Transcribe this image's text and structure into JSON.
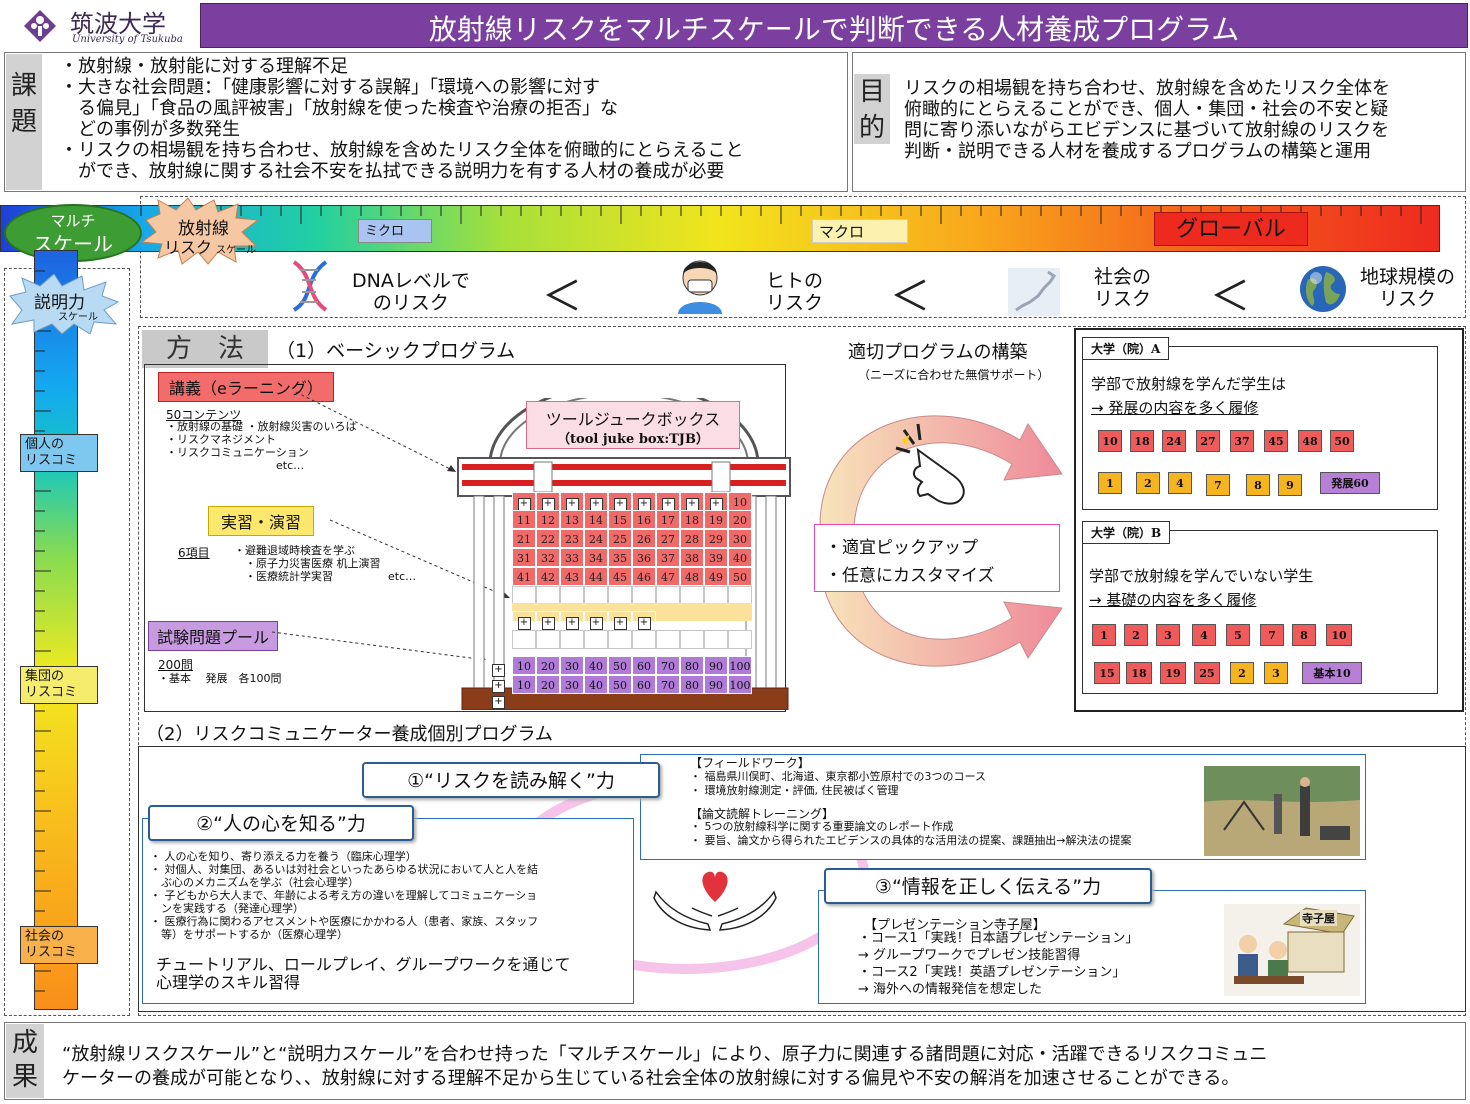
{
  "header": {
    "logo_jp": "筑波大学",
    "logo_en": "University of Tsukuba",
    "title": "放射線リスクをマルチスケールで判断できる人材養成プログラム"
  },
  "issue": {
    "label": "課題",
    "items": [
      "・放射線・放射能に対する理解不足",
      "・大きな社会問題：「健康影響に対する誤解」「環境への影響に対す",
      "　る偏見」「食品の風評被害」「放射線を使った検査や治療の拒否」な",
      "　どの事例が多数発生",
      "・リスクの相場観を持ち合わせ、放射線を含めたリスク全体を俯瞰的にとらえること",
      "　ができ、放射線に関する社会不安を払拭できる説明力を有する人材の養成が必要"
    ]
  },
  "purpose": {
    "label": "目的",
    "lines": [
      "リスクの相場観を持ち合わせ、放射線を含めたリスク全体を",
      "俯瞰的にとらえることができ、個人・集団・社会の不安と疑",
      "問に寄り添いながらエビデンスに基づいて放射線のリスクを",
      "判断・説明できる人材を養成するプログラムの構築と運用"
    ]
  },
  "scale": {
    "multi_line1": "マルチ",
    "multi_line2": "スケール",
    "risk_line1": "放射線",
    "risk_line2": "リスク",
    "risk_small": "スケール",
    "micro": "ミクロ",
    "macro": "マクロ",
    "global": "グローバル",
    "explain_line1": "説明力",
    "explain_small": "スケール",
    "individual": "個人の\nリスコミ",
    "group": "集団の\nリスコミ",
    "society": "社会の\nリスコミ"
  },
  "risk_levels": {
    "dna": "DNAレベルで\nのリスク",
    "human": "ヒトの\nリスク",
    "society": "社会の\nリスク",
    "earth": "地球規模の\nリスク",
    "lt": "＜"
  },
  "method": {
    "label": "方　法",
    "basic_title": "（1）ベーシックプログラム",
    "lecture": "講義（eラーニング）",
    "lecture_count": "50コンテンツ",
    "lecture_items": "・放射線の基礎 ・放射線災害のいろは\n・リスクマネジメント\n・リスクコミュニケーション\n　　　　　　　　　　etc…",
    "practice": "実習・演習",
    "practice_count": "6項目",
    "practice_items": "・避難退域時検査を学ぶ\n　・原子力災害医療 机上演習\n　・医療統計学実習　　　　　etc…",
    "exam": "試験問題プール",
    "exam_count": "200問",
    "exam_items": "・基本　 発展　各100問",
    "tjb_title": "ツールジュークボックス",
    "tjb_sub": "（tool juke box:TJB）",
    "build_title": "適切プログラムの構築",
    "build_sub": "（ニーズに合わせた無償サポート）",
    "pick1": "・適宜ピックアップ",
    "pick2": "・任意にカスタマイズ"
  },
  "tjb_grid": {
    "row0": [
      "",
      "",
      "",
      "",
      "",
      "",
      "",
      "",
      "",
      "10"
    ],
    "rows_red": [
      [
        "11",
        "12",
        "13",
        "14",
        "15",
        "16",
        "17",
        "18",
        "19",
        "20"
      ],
      [
        "21",
        "22",
        "23",
        "24",
        "25",
        "26",
        "27",
        "28",
        "29",
        "30"
      ],
      [
        "31",
        "32",
        "33",
        "34",
        "35",
        "36",
        "37",
        "38",
        "39",
        "40"
      ],
      [
        "41",
        "42",
        "43",
        "44",
        "45",
        "46",
        "47",
        "48",
        "49",
        "50"
      ]
    ],
    "rows_purple": [
      [
        "10",
        "20",
        "30",
        "40",
        "50",
        "60",
        "70",
        "80",
        "90",
        "100"
      ],
      [
        "10",
        "20",
        "30",
        "40",
        "50",
        "60",
        "70",
        "80",
        "90",
        "100"
      ]
    ]
  },
  "univ_a": {
    "title": "大学（院）A",
    "line1": "学部で放射線を学んだ学生は",
    "line2": "→ 発展の内容を多く履修",
    "red": [
      "10",
      "18",
      "24",
      "27",
      "37",
      "45",
      "48",
      "50"
    ],
    "yellow": [
      "1",
      "2",
      "4",
      "7",
      "8",
      "9"
    ],
    "purple": "発展60"
  },
  "univ_b": {
    "title": "大学（院）B",
    "line1": "学部で放射線を学んでいない学生",
    "line2": "→ 基礎の内容を多く履修",
    "red1": [
      "1",
      "2",
      "3",
      "4",
      "5",
      "7",
      "8",
      "10"
    ],
    "red2": [
      "15",
      "18",
      "19",
      "25"
    ],
    "yellow": [
      "2",
      "3"
    ],
    "purple": "基本10"
  },
  "individual": {
    "title": "（2）リスクコミュニケーター養成個別プログラム",
    "power1": "①“リスクを読み解く”力",
    "power2": "②“人の心を知る”力",
    "power3": "③“情報を正しく伝える”力",
    "field_title": "【フィールドワーク】",
    "field_items": "・ 福島県川俣町、北海道、東京都小笠原村での3つのコース\n・ 環境放射線測定・評価, 住民被ばく管理",
    "paper_title": "【論文読解トレーニング】",
    "paper_items": "・ 5つの放射線科学に関する重要論文のレポート作成\n・ 要旨、論文から得られたエビデンスの具体的な活用法の提案、課題抽出→解決法の提案",
    "mind_items": "・ 人の心を知り、寄り添える力を養う（臨床心理学）\n・ 対個人、対集団、あるいは対社会といったあらゆる状況において人と人を結\n　ぶ心のメカニズムを学ぶ（社会心理学）\n・ 子どもから大人まで、年齢による考え方の違いを理解してコミュニケーショ\n　ンを実践する（発達心理学）\n・ 医療行為に関わるアセスメントや医療にかかわる人（患者、家族、スタッフ\n　等）をサポートするか（医療心理学）",
    "mind_footer": "チュートリアル、ロールプレイ、グループワークを通じて\n心理学のスキル習得",
    "pres_title": "【プレゼンテーション寺子屋】",
    "pres_items": "・コース1「実践！日本語プレゼンテーション」\n→ グループワークでプレゼン技能習得\n・コース2「実践！英語プレゼンテーション」\n→ 海外への情報発信を想定した",
    "terakoya": "寺子屋"
  },
  "result": {
    "label": "成果",
    "text1": "“放射線リスクスケール”と“説明力スケール”を合わせ持った「マルチスケール」により、原子力に関連する諸問題に対応・活躍できるリスクコミュニ",
    "text2": "ケーターの養成が可能となり、、放射線に対する理解不足から生じている社会全体の放射線に対する偏見や不安の解消を加速させることができる。"
  },
  "colors": {
    "header_purple": "#7b3fa0",
    "cell_red": "#f06a6a",
    "cell_purple": "#b07ad8",
    "cell_yellow": "#fbe19a",
    "global_red": "#ee2a1f"
  }
}
